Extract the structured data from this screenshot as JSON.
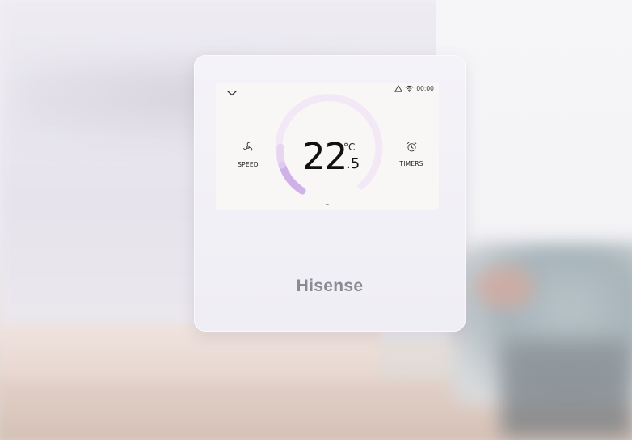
{
  "device": {
    "brand": "Hisense",
    "screen": {
      "status": {
        "clock": "00:00",
        "icons": [
          "warning-icon",
          "wifi-icon"
        ]
      },
      "temperature": {
        "integer": "22",
        "decimal": ".5",
        "unit": "°C"
      },
      "controls": {
        "speed_label": "SPEED",
        "speed_icon": "fan-icon",
        "timers_label": "TIMERS",
        "timers_icon": "alarm-clock-icon",
        "collapse_icon": "chevron-down-icon"
      }
    }
  },
  "colors": {
    "ring_track": "#f2e7f4",
    "ring_active": "#c9a6e6",
    "text": "#111111",
    "brand_text": "#8a8a92"
  }
}
